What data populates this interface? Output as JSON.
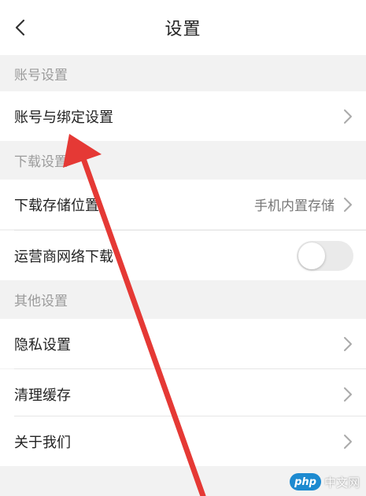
{
  "header": {
    "title": "设置"
  },
  "sections": {
    "account": {
      "title": "账号设置",
      "items": [
        {
          "label": "账号与绑定设置"
        }
      ]
    },
    "download": {
      "title": "下载设置",
      "items": [
        {
          "label": "下载存储位置",
          "value": "手机内置存储"
        },
        {
          "label": "运营商网络下载",
          "toggle": false
        }
      ]
    },
    "other": {
      "title": "其他设置",
      "items": [
        {
          "label": "隐私设置"
        },
        {
          "label": "清理缓存"
        },
        {
          "label": "关于我们"
        }
      ]
    }
  },
  "watermark": {
    "badge": "php",
    "text": "中文网"
  },
  "colors": {
    "annotation_arrow": "#e53935",
    "toggle_off": "#eaeaea"
  }
}
